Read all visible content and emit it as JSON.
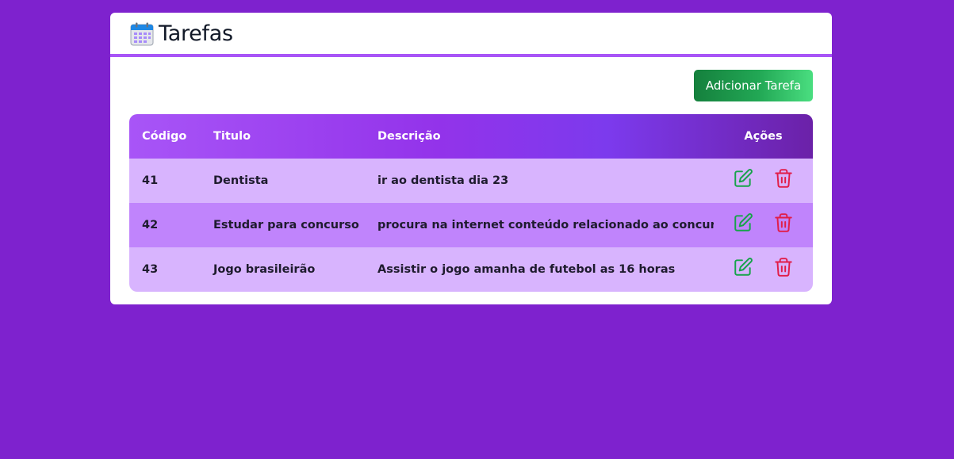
{
  "header": {
    "title": "Tarefas",
    "icon": "calendar-icon"
  },
  "toolbar": {
    "add_label": "Adicionar Tarefa"
  },
  "table": {
    "columns": [
      "Código",
      "Titulo",
      "Descrição",
      "Ações"
    ],
    "rows": [
      {
        "codigo": "41",
        "titulo": "Dentista",
        "descricao": "ir ao dentista dia 23"
      },
      {
        "codigo": "42",
        "titulo": "Estudar para concurso",
        "descricao": "procura na internet conteúdo relacionado ao concurso"
      },
      {
        "codigo": "43",
        "titulo": "Jogo brasileirão",
        "descricao": "Assistir o jogo amanha de futebol as 16 horas"
      }
    ],
    "row_actions": [
      "edit-icon",
      "trash-icon"
    ]
  },
  "colors": {
    "background": "#7e22ce",
    "accent": "#a855f7",
    "add_button": "#16a34a",
    "edit_icon": "#16a34a",
    "delete_icon": "#e11d48"
  }
}
